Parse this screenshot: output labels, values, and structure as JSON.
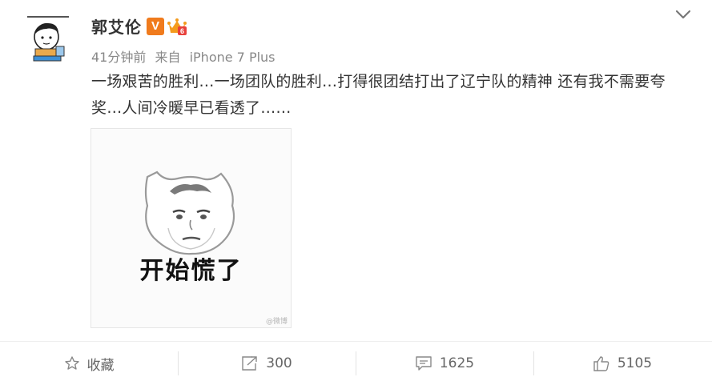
{
  "user": {
    "name": "郭艾伦",
    "verified_badge": "V",
    "avatar_icon": "cartoon-avatar",
    "crown_icon": "vip-crown-icon"
  },
  "meta": {
    "time": "41分钟前",
    "source_prefix": "来自",
    "source": "iPhone 7 Plus"
  },
  "post": {
    "text": "一场艰苦的胜利…一场团队的胜利…打得很团结打出了辽宁队的精神  还有我不需要夸奖…人间冷暖早已看透了……",
    "image": {
      "caption": "开始慌了",
      "watermark": "@微博"
    }
  },
  "actions": [
    {
      "name": "favorite",
      "label": "收藏",
      "icon": "star-icon"
    },
    {
      "name": "repost",
      "label": "300",
      "icon": "share-icon"
    },
    {
      "name": "comment",
      "label": "1625",
      "icon": "comment-icon"
    },
    {
      "name": "like",
      "label": "5105",
      "icon": "thumbs-up-icon"
    }
  ],
  "colors": {
    "verified_orange": "#f07b1d",
    "text": "#333333",
    "meta": "#888888",
    "action": "#666666"
  }
}
